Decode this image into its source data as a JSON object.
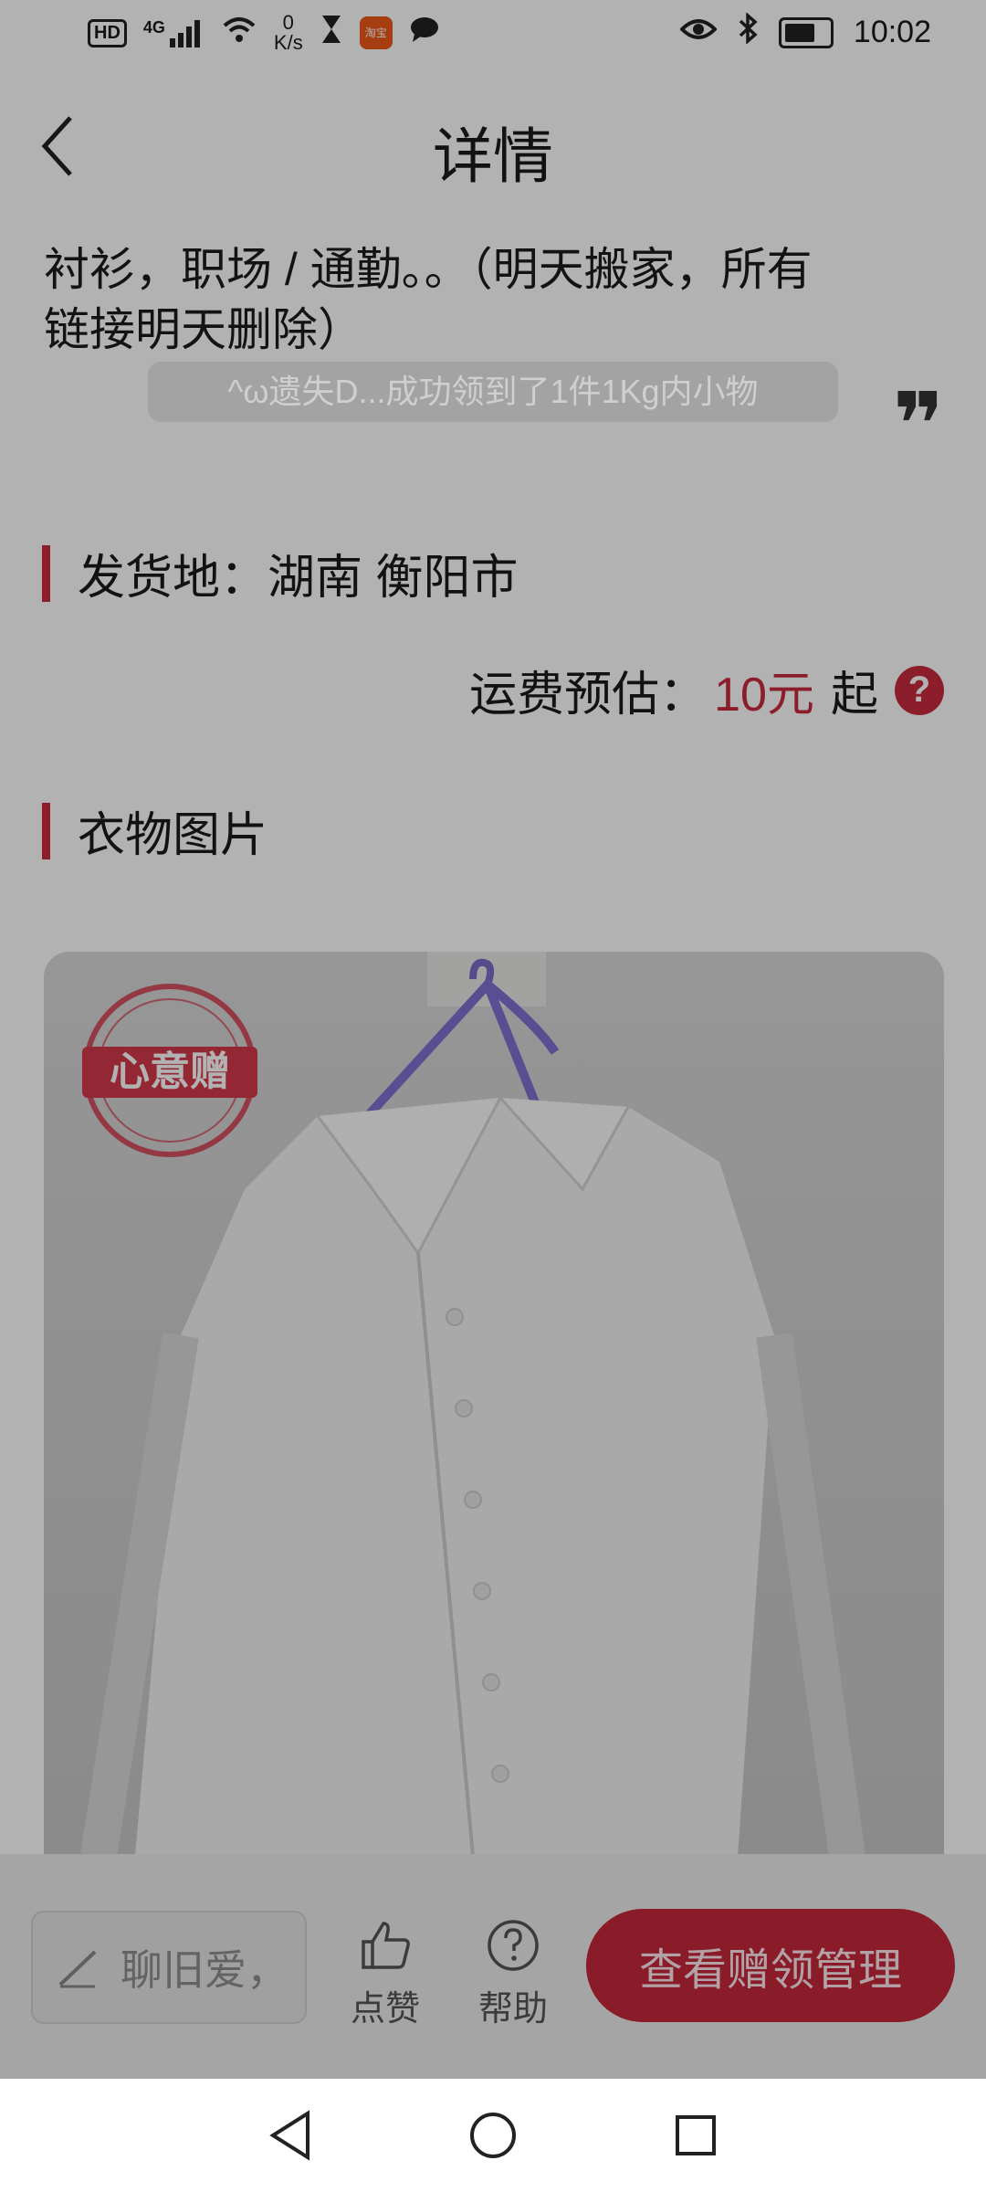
{
  "status_bar": {
    "network_label": "4G",
    "speed_value": "0",
    "speed_unit": "K/s",
    "time": "10:02",
    "app_badge_text": "淘宝",
    "hd_label": "HD"
  },
  "header": {
    "title": "详情"
  },
  "description": {
    "line1": "衬衫，职场 / 通勤。。（明天搬家，所有",
    "line2": "链接明天删除）"
  },
  "toast": "^ω遗失D...成功领到了1件1Kg内小物",
  "shipping": {
    "label": "发货地：湖南 衡阳市"
  },
  "fee": {
    "label": "运费预估：",
    "price": "10元",
    "suffix": "起",
    "help_glyph": "?"
  },
  "photos": {
    "label": "衣物图片",
    "stamp_text": "心意赠"
  },
  "bottom_bar": {
    "chat_placeholder": "聊旧爱，",
    "like_label": "点赞",
    "help_label": "帮助",
    "manage_button": "查看赠领管理"
  },
  "colors": {
    "accent": "#c82b3d",
    "overlay": "rgba(0,0,0,0.30)"
  },
  "icons": {
    "back": "chevron-left-icon",
    "quote": "quote-icon",
    "edit": "pencil-icon",
    "like": "thumbs-up-icon",
    "help": "question-circle-icon"
  }
}
